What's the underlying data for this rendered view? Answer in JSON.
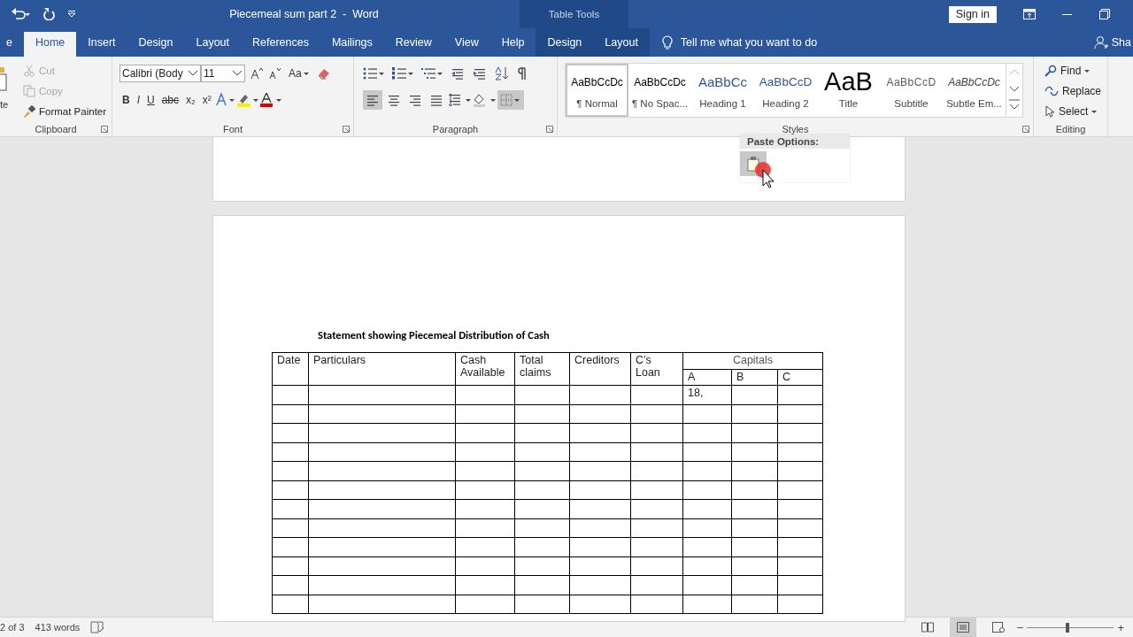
{
  "title_bar": {
    "title": "Piecemeal sum part 2  -  Word",
    "contextual_label": "Table Tools",
    "sign_in": "Sign in"
  },
  "tabs": [
    {
      "label": "e",
      "selected": false,
      "kind": "standard"
    },
    {
      "label": "Home",
      "selected": true,
      "kind": "standard"
    },
    {
      "label": "Insert",
      "selected": false,
      "kind": "standard"
    },
    {
      "label": "Design",
      "selected": false,
      "kind": "standard"
    },
    {
      "label": "Layout",
      "selected": false,
      "kind": "standard"
    },
    {
      "label": "References",
      "selected": false,
      "kind": "standard"
    },
    {
      "label": "Mailings",
      "selected": false,
      "kind": "standard"
    },
    {
      "label": "Review",
      "selected": false,
      "kind": "standard"
    },
    {
      "label": "View",
      "selected": false,
      "kind": "standard"
    },
    {
      "label": "Help",
      "selected": false,
      "kind": "standard"
    },
    {
      "label": "Design",
      "selected": false,
      "kind": "contextual"
    },
    {
      "label": "Layout",
      "selected": false,
      "kind": "contextual"
    }
  ],
  "tell_me": {
    "placeholder": "Tell me what you want to do"
  },
  "share": "Sha",
  "ribbon": {
    "clipboard": {
      "label": "Clipboard",
      "paste": "te",
      "items": [
        {
          "label": "Cut",
          "kind": "cut",
          "disabled": true
        },
        {
          "label": "Copy",
          "kind": "copy",
          "disabled": true
        },
        {
          "label": "Format Painter",
          "kind": "painter",
          "disabled": false
        }
      ]
    },
    "font": {
      "label": "Font",
      "font_name": "Calibri (Body",
      "font_size": "11",
      "case_button": "Aa",
      "format_buttons": [
        {
          "label": "B",
          "kind": "bold"
        },
        {
          "label": "I",
          "kind": "italic"
        },
        {
          "label": "U",
          "kind": "underline"
        },
        {
          "label": "abc",
          "kind": "strike"
        },
        {
          "label": "x₂",
          "kind": "sub"
        },
        {
          "label": "x²",
          "kind": "sup"
        }
      ]
    },
    "paragraph": {
      "label": "Paragraph",
      "alignments": [
        {
          "kind": "left",
          "selected": true
        },
        {
          "kind": "center",
          "selected": false
        },
        {
          "kind": "right",
          "selected": false
        },
        {
          "kind": "justify",
          "selected": false
        }
      ],
      "borders_selected": true
    },
    "styles": {
      "label": "Styles",
      "items": [
        {
          "preview": "AaBbCcDc",
          "name": "¶ Normal",
          "kind": "normal",
          "selected": true
        },
        {
          "preview": "AaBbCcDc",
          "name": "¶ No Spac...",
          "kind": "normal",
          "selected": false
        },
        {
          "preview": "AaBbCc",
          "name": "Heading 1",
          "kind": "heading1",
          "selected": false
        },
        {
          "preview": "AaBbCcD",
          "name": "Heading 2",
          "kind": "heading2",
          "selected": false
        },
        {
          "preview": "AaB",
          "name": "Title",
          "kind": "title",
          "selected": false
        },
        {
          "preview": "AaBbCcD",
          "name": "Subtitle",
          "kind": "subtitle",
          "selected": false
        },
        {
          "preview": "AaBbCcDc",
          "name": "Subtle Em...",
          "kind": "emphasis",
          "selected": false
        }
      ]
    },
    "editing": {
      "label": "Editing",
      "items": [
        {
          "label": "Find",
          "kind": "find"
        },
        {
          "label": "Replace",
          "kind": "replace"
        },
        {
          "label": "Select",
          "kind": "select"
        }
      ]
    }
  },
  "paste_options": {
    "title": "Paste Options:"
  },
  "document": {
    "heading": "Statement showing Piecemeal Distribution of Cash",
    "columns": [
      "Date",
      "Particulars",
      "Cash Available",
      "Total claims",
      "Creditors",
      "C’s Loan"
    ],
    "group_header": "Capitals",
    "sub_columns": [
      "A",
      "B",
      "C"
    ],
    "rows": [
      {
        "capital_a": "18,"
      },
      {},
      {},
      {},
      {},
      {},
      {},
      {},
      {},
      {},
      {},
      {}
    ]
  },
  "status_bar": {
    "page": "2 of 3",
    "words": "413 words",
    "zoom_out": "−",
    "zoom_in": "+",
    "zoom": {
      "level": 0.47
    }
  }
}
